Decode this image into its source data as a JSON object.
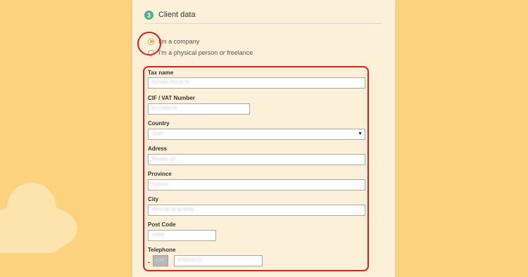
{
  "section": {
    "step_number": "3",
    "title": "Client data"
  },
  "client_type": {
    "options": [
      {
        "label": "I'm a company",
        "selected": true
      },
      {
        "label": "I'm a physical person or freelance",
        "selected": false
      }
    ]
  },
  "form": {
    "tax_name": {
      "label": "Tax name",
      "value": "Nombre Fiscal SL"
    },
    "vat_number": {
      "label": "CIF / VAT Number",
      "value": "B12345678"
    },
    "country": {
      "label": "Country",
      "value": "Spain"
    },
    "address": {
      "label": "Adress",
      "value": "Rosario 12"
    },
    "province": {
      "label": "Province",
      "value": "Huesca"
    },
    "city": {
      "label": "City",
      "value": "Torrente de la Mota"
    },
    "post_code": {
      "label": "Post Code",
      "value": "11000"
    },
    "telephone": {
      "label": "Telephone",
      "separator": "-",
      "prefix": "+34",
      "value": "976543210"
    }
  },
  "colors": {
    "background": "#fbd27e",
    "panel": "#fdf0d8",
    "step_badge": "#4bb18d",
    "radio_selected": "#f39c3b",
    "highlight": "#e31b1b"
  }
}
